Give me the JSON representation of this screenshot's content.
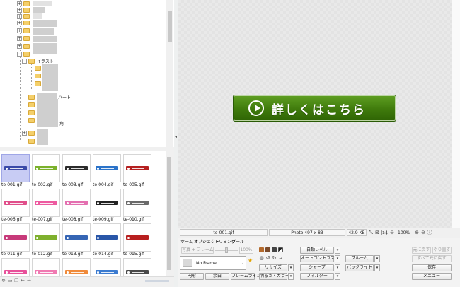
{
  "preview": {
    "button_text": "詳しくはこちら"
  },
  "tree": {
    "items": [
      {
        "label": "イラスト"
      },
      {
        "label": "ハート"
      },
      {
        "label": "角"
      }
    ]
  },
  "thumbnails": [
    {
      "label": "te-001.gif",
      "color": "#3b4aa8"
    },
    {
      "label": "te-002.gif",
      "color": "#7bb12c"
    },
    {
      "label": "te-003.gif",
      "color": "#2c2c2c"
    },
    {
      "label": "te-004.gif",
      "color": "#2b73c9"
    },
    {
      "label": "te-005.gif",
      "color": "#b52020"
    },
    {
      "label": "te-006.gif",
      "color": "#e04e8a"
    },
    {
      "label": "te-007.gif",
      "color": "#ed5aa0"
    },
    {
      "label": "te-008.gif",
      "color": "#e46fb0"
    },
    {
      "label": "te-009.gif",
      "color": "#222222"
    },
    {
      "label": "te-010.gif",
      "color": "#6a6a6a"
    },
    {
      "label": "te-011.gif",
      "color": "#c73a7a"
    },
    {
      "label": "te-012.gif",
      "color": "#7fb02e"
    },
    {
      "label": "te-013.gif",
      "color": "#3565b4"
    },
    {
      "label": "te-014.gif",
      "color": "#2956a8"
    },
    {
      "label": "te-015.gif",
      "color": "#b81f1f"
    },
    {
      "label": "",
      "color": "#e8509a"
    },
    {
      "label": "",
      "color": "#f07ab2"
    },
    {
      "label": "",
      "color": "#f08a3a"
    },
    {
      "label": "",
      "color": "#3b7bd0"
    },
    {
      "label": "",
      "color": "#4a4a4a"
    }
  ],
  "statusbar": {
    "filename": "te-001.gif",
    "photo_info": "Photo 497 x 83",
    "filesize": "42.9 KB",
    "zoom": "100%"
  },
  "ribbon": {
    "tabs": [
      "ホーム",
      "オブジェクト",
      "トリミング",
      "ツール"
    ],
    "photo_frame": "写真 + フレーム",
    "frame_percent": "100%",
    "frame_name": "No Frame",
    "circle": "円形",
    "margin": "余白",
    "frame_line": "フレームライン",
    "resize": "リサイズ",
    "brightness_color": "明るさ・カラー",
    "auto_level": "自動レベル",
    "auto_contrast": "オートコントラスト",
    "sharpen": "シャープ",
    "filter": "フィルター",
    "bloom": "ブルーム",
    "backlight": "バックライト",
    "undo": "元に戻す",
    "redo": "やり直す",
    "undo_all": "すべて元に戻す",
    "save": "保存",
    "menu": "メニュー"
  }
}
